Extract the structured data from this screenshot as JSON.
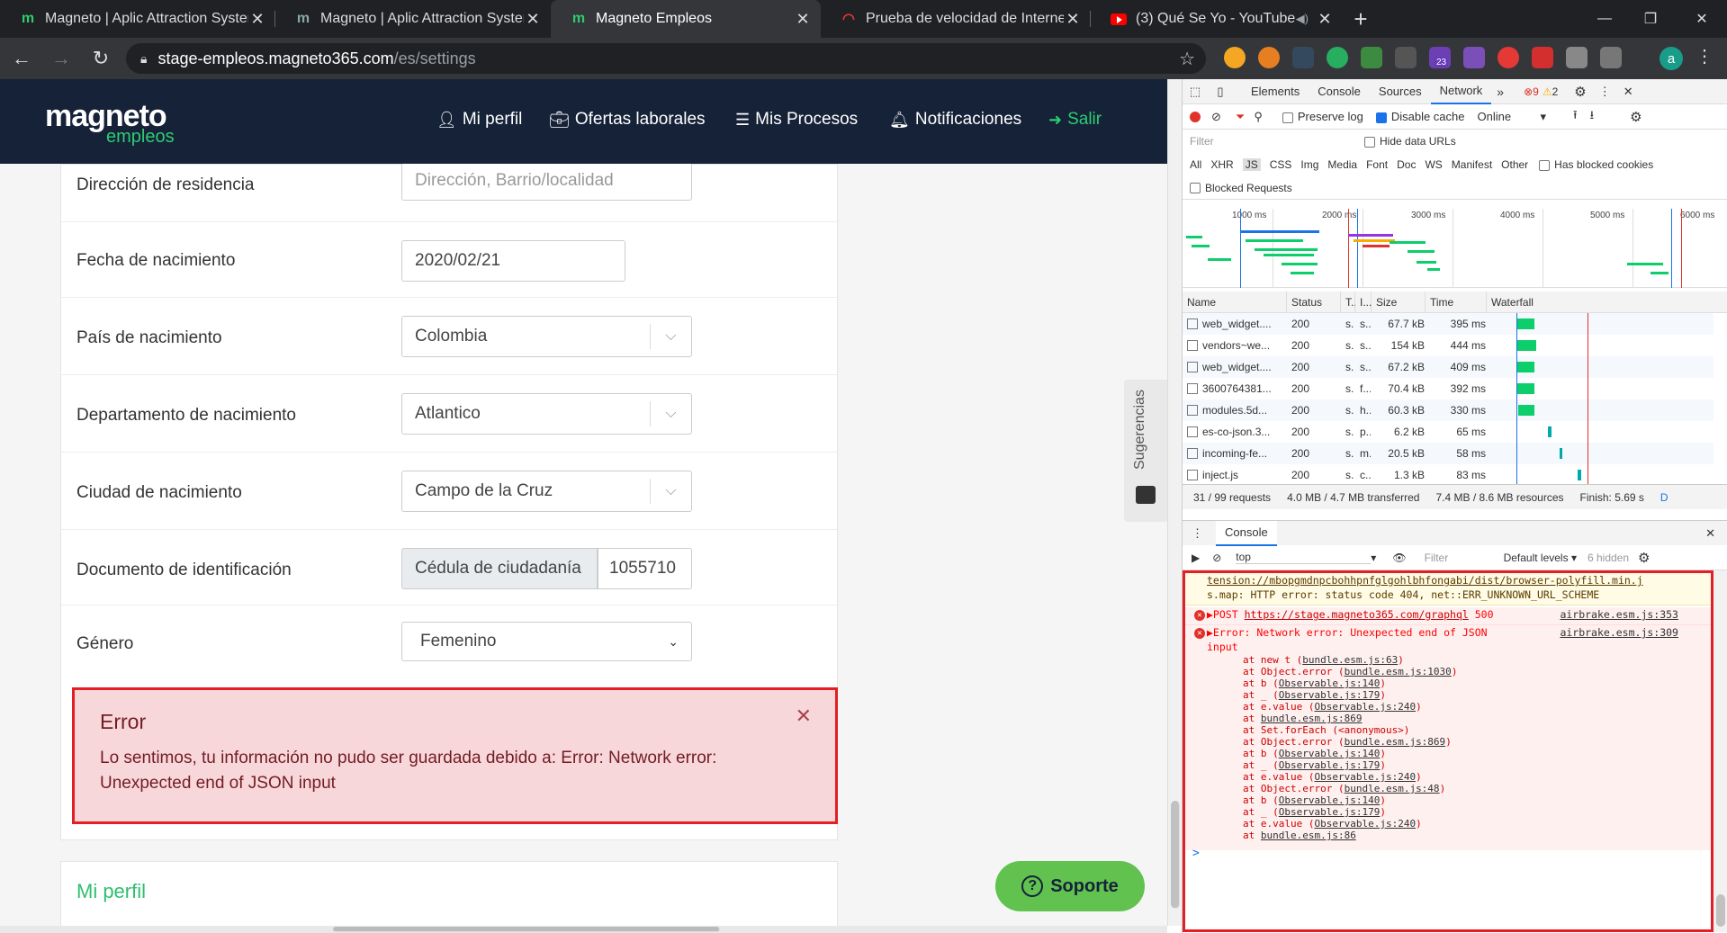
{
  "tabs": [
    {
      "title": "Magneto | Aplic Attraction System",
      "favicon": "magneto-m-icon",
      "color": "#2ecc71"
    },
    {
      "title": "Magneto | Aplic Attraction System",
      "favicon": "magneto-m-icon",
      "color": "#557"
    },
    {
      "title": "Magneto Empleos",
      "favicon": "magneto-m-icon",
      "color": "#2ecc71"
    },
    {
      "title": "Prueba de velocidad de Internet | Fast",
      "favicon": "speedtest-icon",
      "color": "#e33"
    },
    {
      "title": "(3) Qué Se Yo - YouTube",
      "favicon": "youtube-icon",
      "color": "#f00"
    }
  ],
  "address": {
    "host": "stage-empleos.magneto365.com",
    "path": "/es/settings"
  },
  "profile_initial": "a",
  "extension_badge": "23",
  "site": {
    "logo_main": "magneto",
    "logo_sub": "empleos",
    "nav": [
      "Mi perfil",
      "Ofertas laborales",
      "Mis Procesos",
      "Notificaciones",
      "Salir"
    ]
  },
  "form": {
    "rows": [
      {
        "label": "Dirección de residencia",
        "value": "Dirección, Barrio/localidad",
        "placeholder": true
      },
      {
        "label": "Fecha de nacimiento",
        "value": "2020/02/21"
      },
      {
        "label": "País de nacimiento",
        "value": "Colombia"
      },
      {
        "label": "Departamento de nacimiento",
        "value": "Atlantico"
      },
      {
        "label": "Ciudad de nacimiento",
        "value": "Campo de la Cruz"
      },
      {
        "label": "Documento de identificación",
        "doc_type": "Cédula de ciudadanía",
        "value": "1055710"
      },
      {
        "label": "Género",
        "value": "Femenino"
      }
    ]
  },
  "alert": {
    "title": "Error",
    "message": "Lo sentimos, tu información no pudo ser guardada debido a: Error: Network error: Unexpected end of JSON input"
  },
  "section_title": "Mi perfil",
  "suggestions_label": "Sugerencias",
  "support_label": "Soporte",
  "devtools": {
    "tabs": [
      "Elements",
      "Console",
      "Sources",
      "Network"
    ],
    "more": "»",
    "error_count": "9",
    "warning_count": "2",
    "preserve_log": "Preserve log",
    "disable_cache": "Disable cache",
    "throttle": "Online",
    "filter_placeholder": "Filter",
    "hide_data_urls": "Hide data URLs",
    "types": [
      "All",
      "XHR",
      "JS",
      "CSS",
      "Img",
      "Media",
      "Font",
      "Doc",
      "WS",
      "Manifest",
      "Other"
    ],
    "has_blocked": "Has blocked cookies",
    "blocked_requests": "Blocked Requests",
    "ticks": [
      "1000 ms",
      "2000 ms",
      "3000 ms",
      "4000 ms",
      "5000 ms",
      "6000 ms"
    ],
    "columns": [
      "Name",
      "Status",
      "T..",
      "I...",
      "Size",
      "Time",
      "Waterfall"
    ],
    "requests": [
      {
        "name": "web_widget....",
        "status": "200",
        "type": "s.",
        "init": "s...",
        "size": "67.7 kB",
        "time": "395 ms",
        "wf": [
          0.13,
          0.08
        ]
      },
      {
        "name": "vendors~we...",
        "status": "200",
        "type": "s.",
        "init": "s...",
        "size": "154 kB",
        "time": "444 ms",
        "wf": [
          0.13,
          0.09
        ]
      },
      {
        "name": "web_widget....",
        "status": "200",
        "type": "s.",
        "init": "s...",
        "size": "67.2 kB",
        "time": "409 ms",
        "wf": [
          0.13,
          0.08
        ]
      },
      {
        "name": "3600764381...",
        "status": "200",
        "type": "s.",
        "init": "f...",
        "size": "70.4 kB",
        "time": "392 ms",
        "wf": [
          0.13,
          0.08
        ]
      },
      {
        "name": "modules.5d...",
        "status": "200",
        "type": "s.",
        "init": "h...",
        "size": "60.3 kB",
        "time": "330 ms",
        "wf": [
          0.14,
          0.07
        ]
      },
      {
        "name": "es-co-json.3...",
        "status": "200",
        "type": "s.",
        "init": "p...",
        "size": "6.2 kB",
        "time": "65 ms",
        "wf": [
          0.27,
          0.015
        ]
      },
      {
        "name": "incoming-fe...",
        "status": "200",
        "type": "s.",
        "init": "m...",
        "size": "20.5 kB",
        "time": "58 ms",
        "wf": [
          0.32,
          0.015
        ]
      },
      {
        "name": "inject.js",
        "status": "200",
        "type": "s.",
        "init": "c...",
        "size": "1.3 kB",
        "time": "83 ms",
        "wf": [
          0.4,
          0.015
        ]
      }
    ],
    "summary": [
      "31 / 99 requests",
      "4.0 MB / 4.7 MB transferred",
      "7.4 MB / 8.6 MB resources",
      "Finish: 5.69 s",
      "D"
    ],
    "drawer_tab": "Console",
    "context": "top",
    "console_filter": "Filter",
    "levels": "Default levels",
    "hidden": "6 hidden",
    "warn_lines": [
      "tension://mbopgmdnpcbohhpnfglgohlbhfongabi/dist/browser-polyfill.min.j",
      "s.map: HTTP error: status code 404, net::ERR_UNKNOWN_URL_SCHEME"
    ],
    "post_line": {
      "method": "▶POST",
      "url": "https://stage.magneto365.com/graphql",
      "code": "500",
      "src": "airbrake.esm.js:353"
    },
    "error_line": {
      "text": "▶Error: Network error: Unexpected end of JSON",
      "cont": "input",
      "src": "airbrake.esm.js:309"
    },
    "stack": [
      [
        "at new t (",
        "bundle.esm.js:63",
        ")"
      ],
      [
        "at Object.error (",
        "bundle.esm.js:1030",
        ")"
      ],
      [
        "at b (",
        "Observable.js:140",
        ")"
      ],
      [
        "at _ (",
        "Observable.js:179",
        ")"
      ],
      [
        "at e.value (",
        "Observable.js:240",
        ")"
      ],
      [
        "at ",
        "bundle.esm.js:869",
        ""
      ],
      [
        "at Set.forEach (<anonymous>)",
        "",
        ""
      ],
      [
        "at Object.error (",
        "bundle.esm.js:869",
        ")"
      ],
      [
        "at b (",
        "Observable.js:140",
        ")"
      ],
      [
        "at _ (",
        "Observable.js:179",
        ")"
      ],
      [
        "at e.value (",
        "Observable.js:240",
        ")"
      ],
      [
        "at Object.error (",
        "bundle.esm.js:48",
        ")"
      ],
      [
        "at b (",
        "Observable.js:140",
        ")"
      ],
      [
        "at _ (",
        "Observable.js:179",
        ")"
      ],
      [
        "at e.value (",
        "Observable.js:240",
        ")"
      ],
      [
        "at ",
        "bundle.esm.js:86",
        ""
      ]
    ],
    "prompt": ">"
  }
}
